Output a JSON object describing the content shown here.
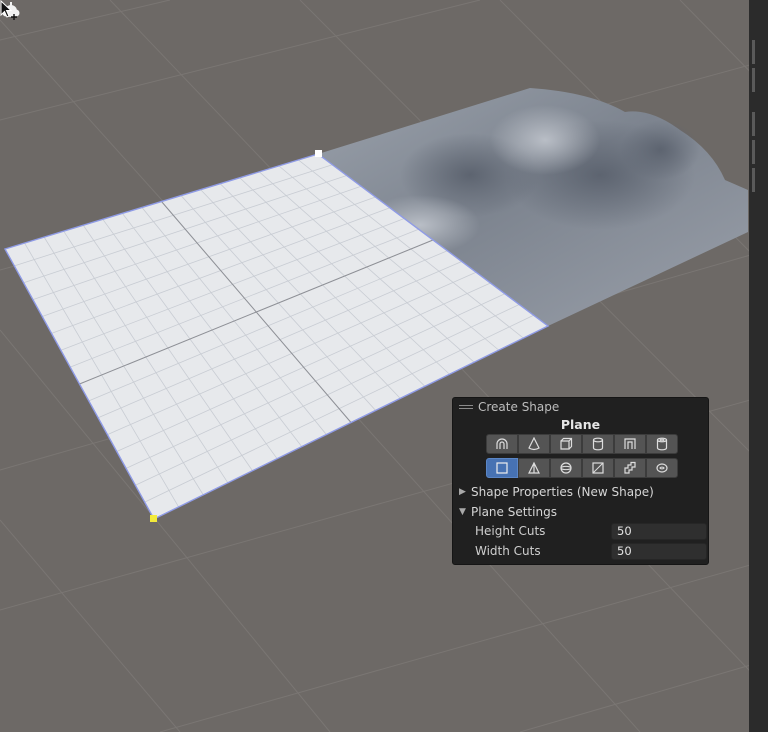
{
  "panel": {
    "title": "Create Shape",
    "shape_name": "Plane",
    "shape_buttons_row1": [
      "arch-icon",
      "cone-icon",
      "cube-icon",
      "cylinder-icon",
      "door-icon",
      "pipe-icon"
    ],
    "shape_buttons_row2": [
      "plane-icon",
      "prism-icon",
      "sphere-icon",
      "stairs-icon",
      "torus-icon",
      "sprite-icon"
    ],
    "active_shape": "plane-icon",
    "shape_properties_label": "Shape Properties (New Shape)",
    "plane_settings_label": "Plane Settings",
    "height_cuts_label": "Height Cuts",
    "height_cuts_value": "50",
    "width_cuts_label": "Width Cuts",
    "width_cuts_value": "50"
  },
  "colors": {
    "viewport_bg": "#6d6966",
    "plane_fill": "#e7e9ec",
    "plane_outline": "#8f9be6",
    "panel_bg": "#202020",
    "active_button": "#4772b3",
    "handle_white": "#ffffff",
    "handle_yellow": "#f3ea3a"
  }
}
